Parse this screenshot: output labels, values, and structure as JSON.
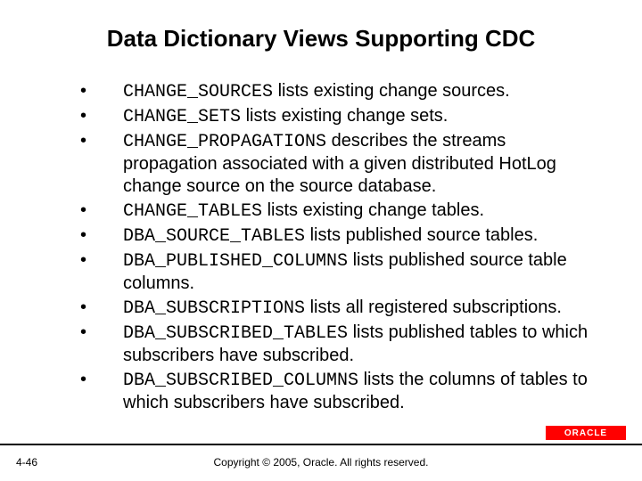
{
  "title": "Data Dictionary Views Supporting CDC",
  "bullets": [
    {
      "code": "CHANGE_SOURCES",
      "rest": " lists existing change sources."
    },
    {
      "code": "CHANGE_SETS",
      "rest": " lists existing change sets."
    },
    {
      "code": "CHANGE_PROPAGATIONS",
      "rest": " describes the streams propagation associated with a given distributed HotLog change source on the source database."
    },
    {
      "code": "CHANGE_TABLES",
      "rest": " lists existing change tables."
    },
    {
      "code": "DBA_SOURCE_TABLES",
      "rest": " lists published source tables."
    },
    {
      "code": "DBA_PUBLISHED_COLUMNS",
      "rest": " lists published source table columns."
    },
    {
      "code": "DBA_SUBSCRIPTIONS",
      "rest": " lists all registered subscriptions."
    },
    {
      "code": "DBA_SUBSCRIBED_TABLES",
      "rest": " lists published tables to which subscribers have subscribed."
    },
    {
      "code": "DBA_SUBSCRIBED_COLUMNS",
      "rest": " lists the columns of tables to which subscribers have subscribed."
    }
  ],
  "pageNumber": "4-46",
  "copyright": "Copyright © 2005, Oracle. All rights reserved.",
  "logoText": "ORACLE"
}
